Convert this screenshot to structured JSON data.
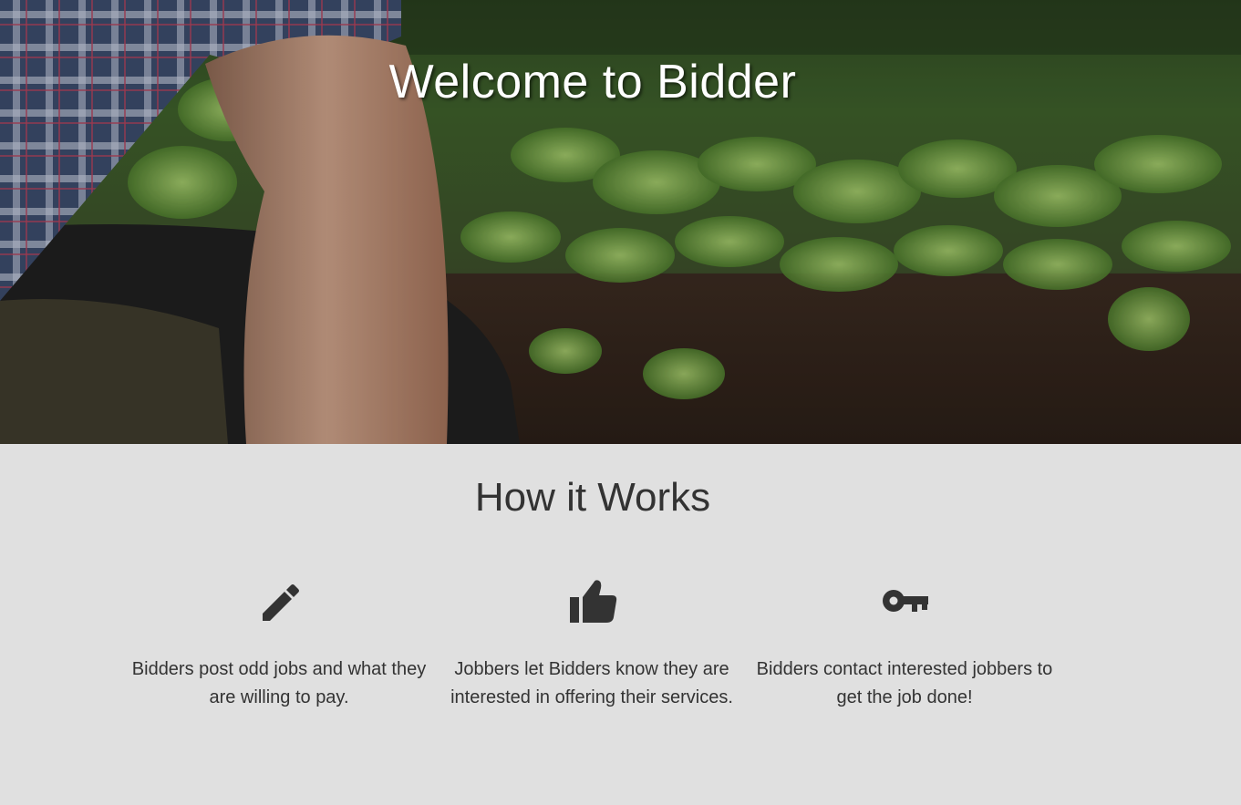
{
  "hero": {
    "title": "Welcome to Bidder",
    "background": "farmer-kneeling-in-vegetable-field-photo"
  },
  "how_it_works": {
    "title": "How it Works",
    "steps": [
      {
        "icon": "pencil-icon",
        "text": "Bidders post odd jobs and what they are willing to pay."
      },
      {
        "icon": "thumbs-up-icon",
        "text": "Jobbers let Bidders know they are interested in offering their services."
      },
      {
        "icon": "key-icon",
        "text": "Bidders contact interested jobbers to get the job done!"
      }
    ]
  },
  "colors": {
    "section_background": "#e0e0e0",
    "text_dark": "#333333",
    "hero_title": "#ffffff"
  }
}
